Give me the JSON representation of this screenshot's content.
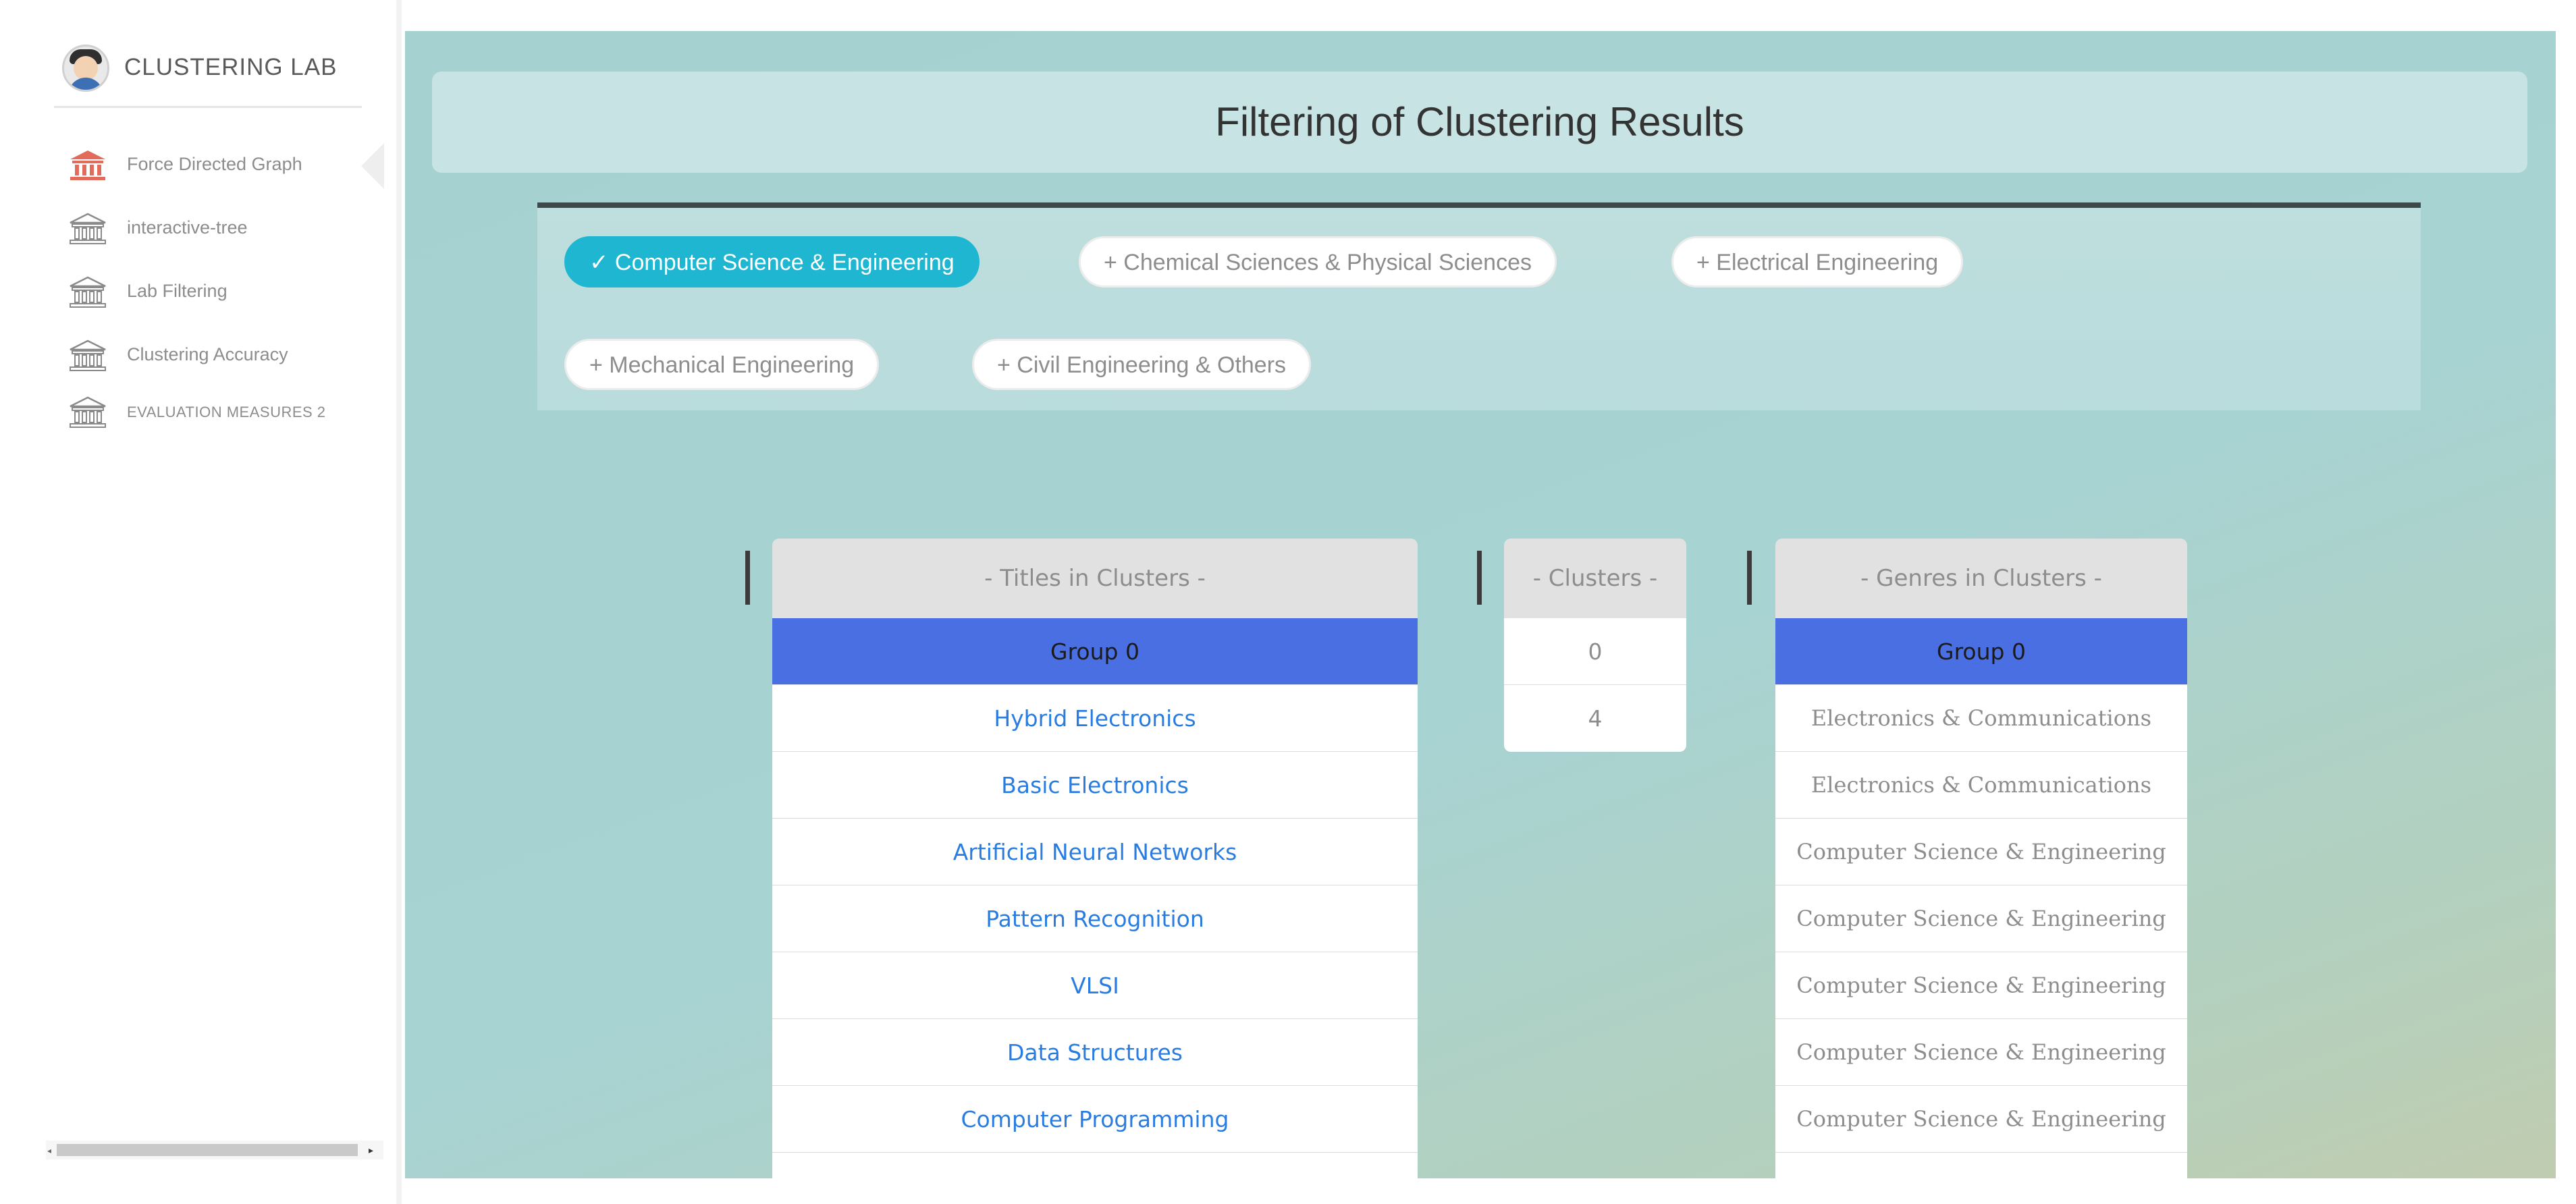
{
  "sidebar": {
    "brand": "CLUSTERING LAB",
    "items": [
      {
        "label": "Force Directed Graph",
        "icon": "bank-icon",
        "active": true
      },
      {
        "label": "interactive-tree",
        "icon": "bank-icon"
      },
      {
        "label": "Lab Filtering",
        "icon": "bank-icon"
      },
      {
        "label": "Clustering Accuracy",
        "icon": "bank-icon"
      },
      {
        "label": "EVALUATION MEASURES 2",
        "icon": "bank-icon"
      }
    ]
  },
  "colors": {
    "active_icon": "#e26b5c",
    "inactive_icon": "#8a8a8a",
    "active_chip": "#1fb6d1",
    "group_row": "#4a6fe3",
    "link_text": "#2a7de0"
  },
  "main": {
    "title": "Filtering of Clustering Results",
    "filters": [
      {
        "label": "✓ Computer Science & Engineering",
        "active": true
      },
      {
        "label": "+ Chemical Sciences & Physical Sciences",
        "active": false
      },
      {
        "label": "+ Electrical Engineering",
        "active": false
      },
      {
        "label": "+ Mechanical Engineering",
        "active": false
      },
      {
        "label": "+ Civil Engineering & Others",
        "active": false
      }
    ],
    "titles_table": {
      "header": "- Titles in Clusters -",
      "rows": [
        "Group 0",
        "Hybrid Electronics",
        "Basic Electronics",
        "Artificial Neural Networks",
        "Pattern Recognition",
        "VLSI",
        "Data Structures",
        "Computer Programming",
        ""
      ]
    },
    "clusters_table": {
      "header": "- Clusters -",
      "rows": [
        "0",
        "4"
      ]
    },
    "genres_table": {
      "header": "- Genres in Clusters -",
      "rows": [
        "Group 0",
        "Electronics & Communications",
        "Electronics & Communications",
        "Computer Science & Engineering",
        "Computer Science & Engineering",
        "Computer Science & Engineering",
        "Computer Science & Engineering",
        "Computer Science & Engineering",
        ""
      ]
    }
  }
}
